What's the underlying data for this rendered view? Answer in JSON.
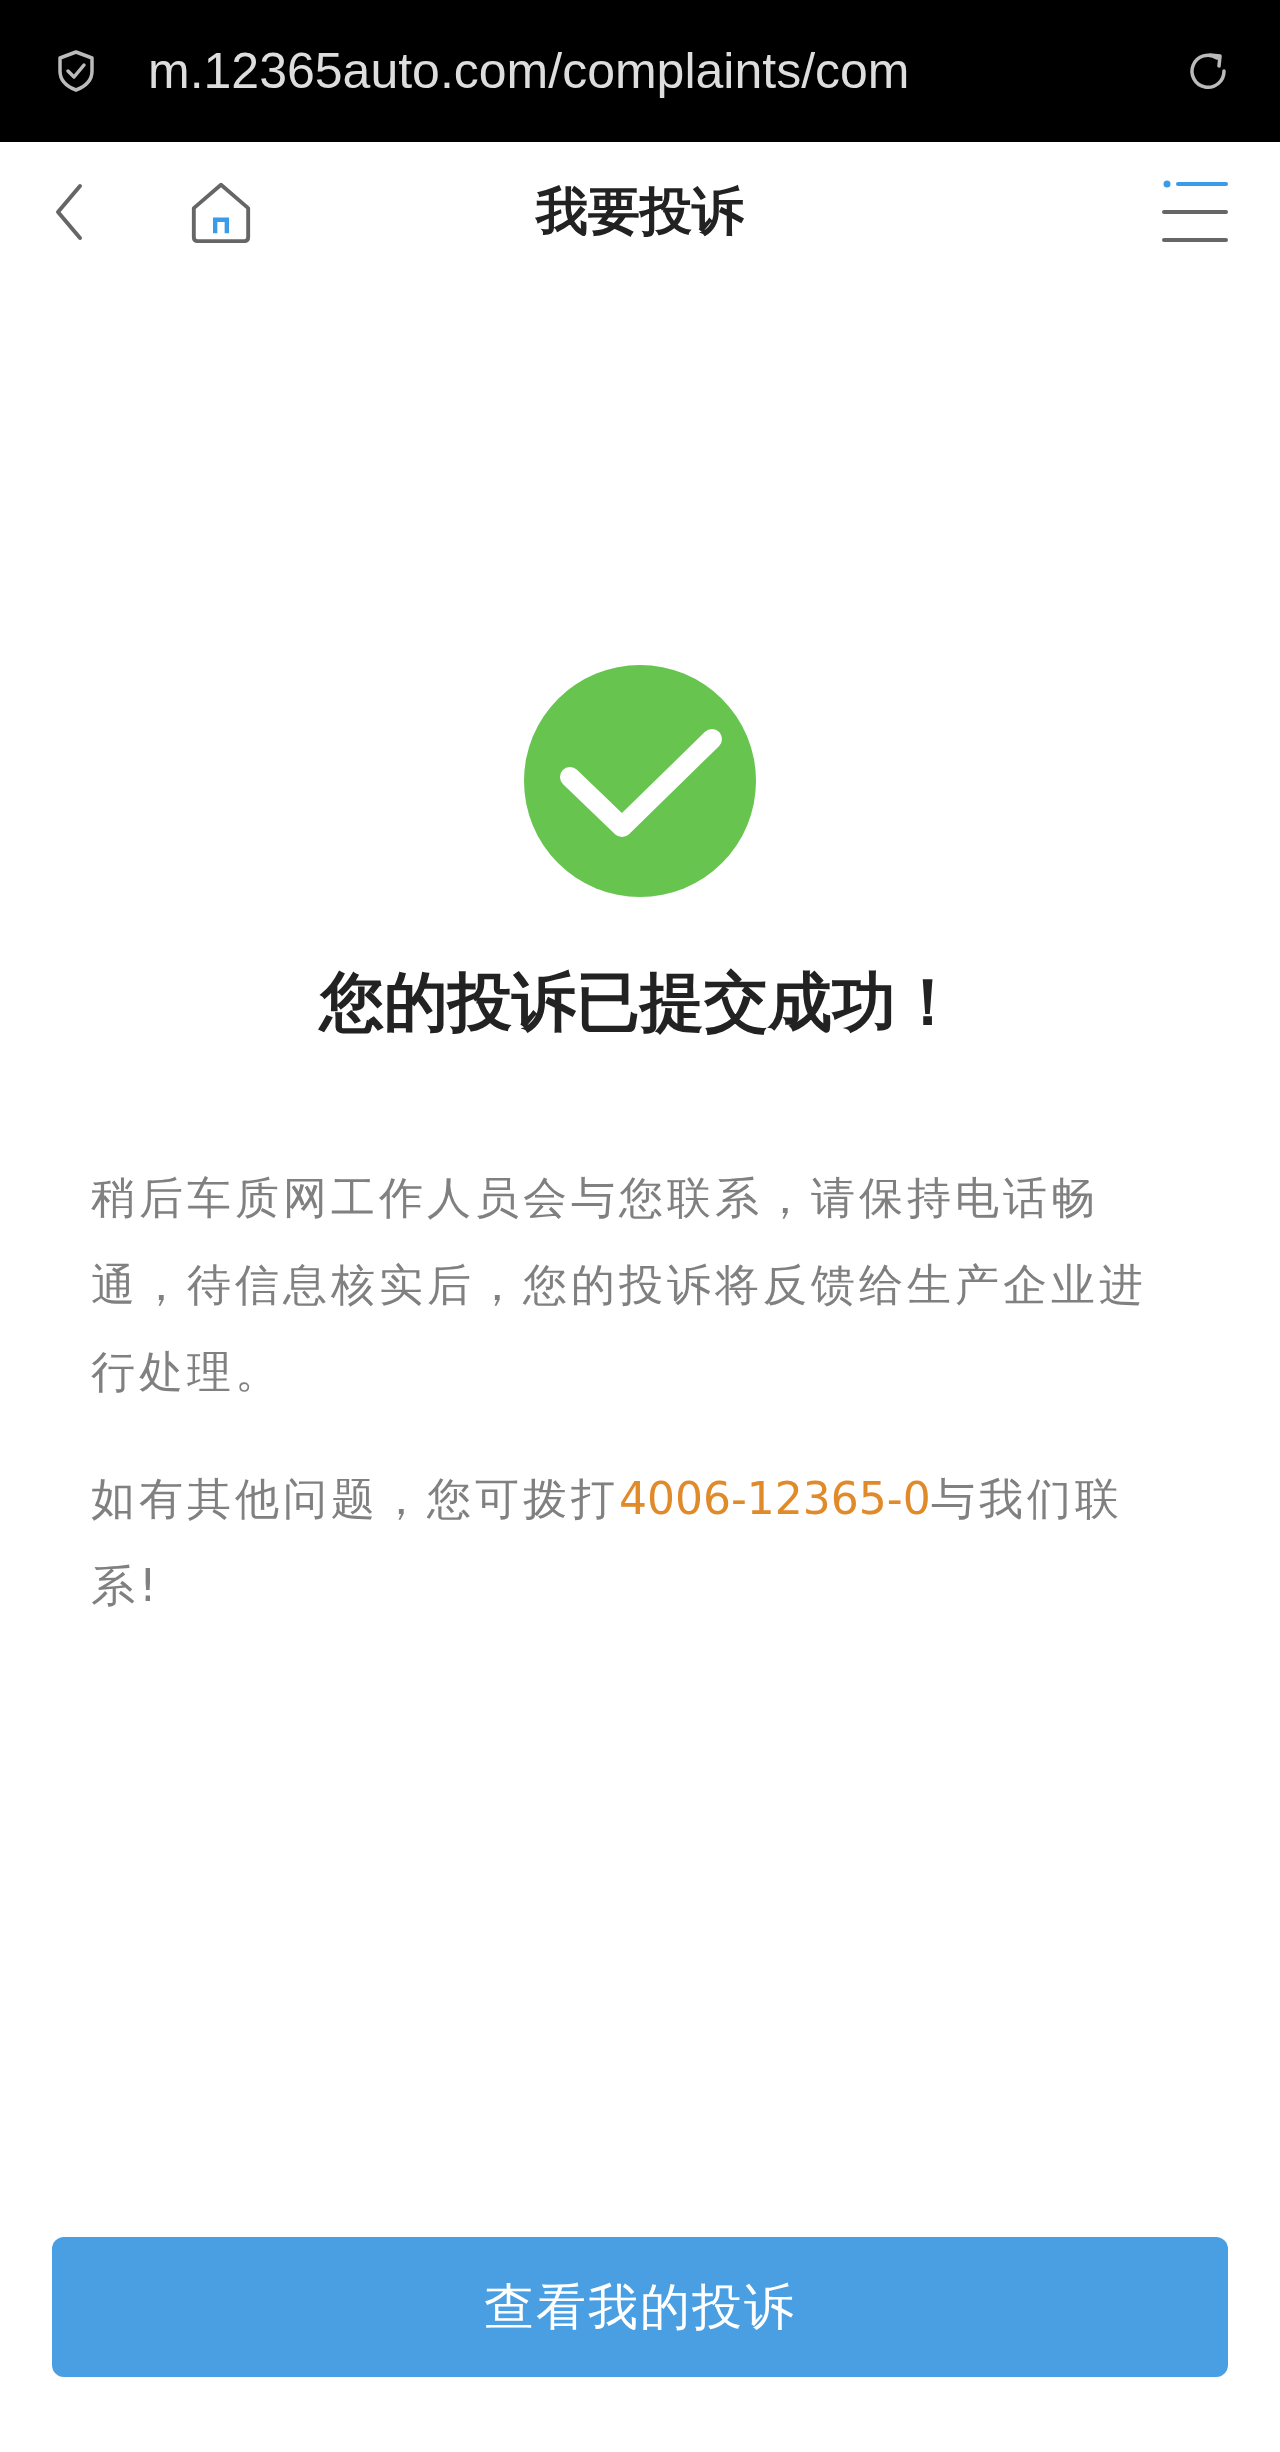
{
  "browser_bar": {
    "url": "m.12365auto.com/complaints/com"
  },
  "header": {
    "title": "我要投诉"
  },
  "result": {
    "success": true,
    "title": "您的投诉已提交成功！",
    "message": "稍后车质网工作人员会与您联系，请保持电话畅通，待信息核实后，您的投诉将反馈给生产企业进行处理。",
    "contact": {
      "before": "如有其他问题，您可拨打",
      "phone": "4006-12365-0",
      "after": "与我们联系!"
    }
  },
  "button": {
    "label": "查看我的投诉"
  }
}
